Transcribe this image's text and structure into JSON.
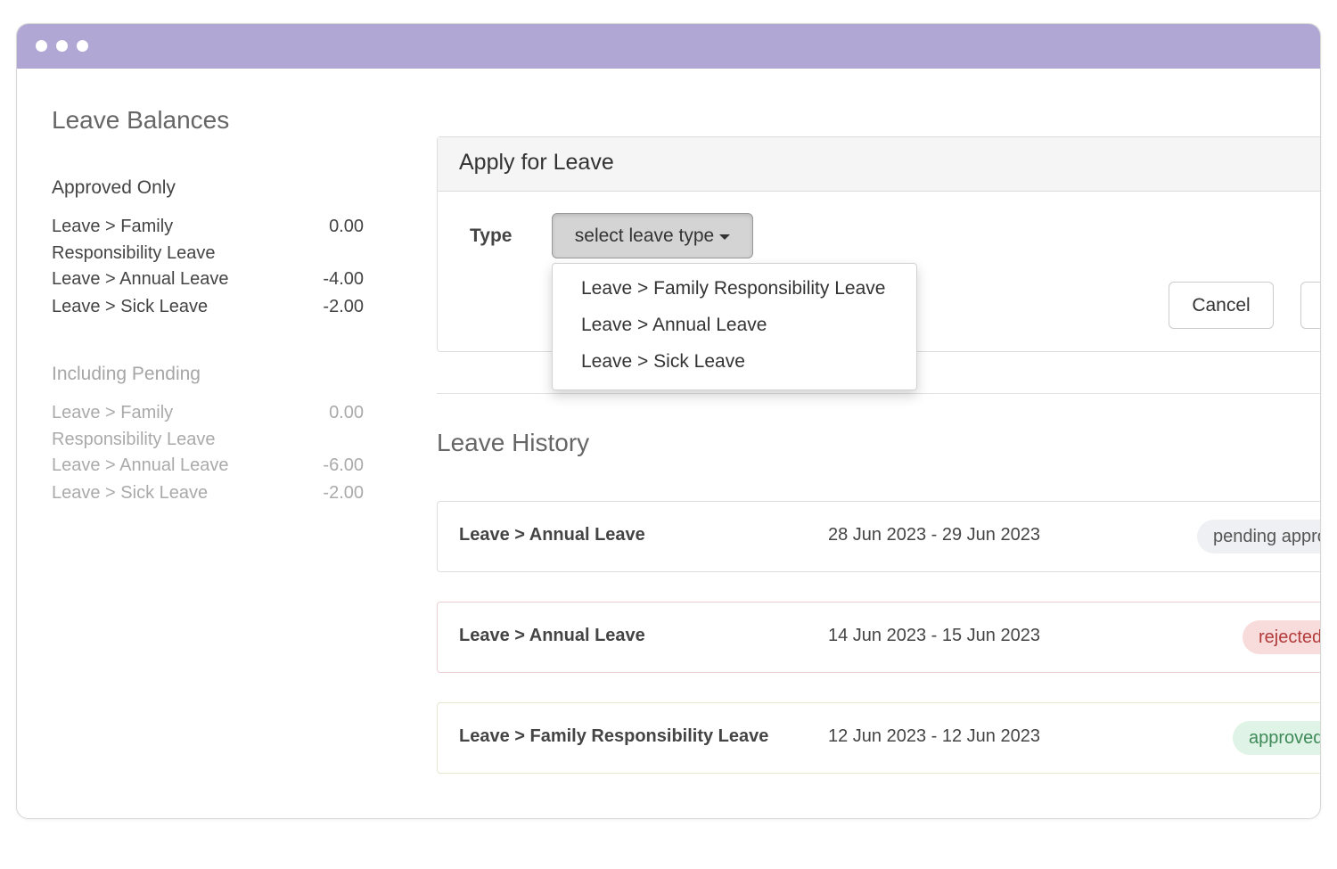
{
  "balances": {
    "title": "Leave Balances",
    "approved": {
      "title": "Approved Only",
      "items": [
        {
          "label": "Leave > Family Responsibility Leave",
          "value": "0.00"
        },
        {
          "label": "Leave > Annual Leave",
          "value": "-4.00"
        },
        {
          "label": "Leave > Sick Leave",
          "value": "-2.00"
        }
      ]
    },
    "pending": {
      "title": "Including Pending",
      "items": [
        {
          "label": "Leave > Family Responsibility Leave",
          "value": "0.00"
        },
        {
          "label": "Leave > Annual Leave",
          "value": "-6.00"
        },
        {
          "label": "Leave > Sick Leave",
          "value": "-2.00"
        }
      ]
    }
  },
  "apply": {
    "title": "Apply for Leave",
    "type_label": "Type",
    "select_label": "select leave type",
    "options": [
      "Leave > Family Responsibility Leave",
      "Leave > Annual Leave",
      "Leave > Sick Leave"
    ],
    "cancel_label": "Cancel"
  },
  "history": {
    "title": "Leave History",
    "rows": [
      {
        "type": "Leave > Annual Leave",
        "dates": "28 Jun 2023 - 29 Jun 2023",
        "status": "pending approval"
      },
      {
        "type": "Leave > Annual Leave",
        "dates": "14 Jun 2023 - 15 Jun 2023",
        "status": "rejected"
      },
      {
        "type": "Leave > Family Responsibility Leave",
        "dates": "12 Jun 2023 - 12 Jun 2023",
        "status": "approved"
      }
    ]
  },
  "colors": {
    "titlebar": "#b1a7d4",
    "pending_badge": "#eef0f3",
    "rejected_badge": "#f8dcdc",
    "approved_badge": "#dff3e6"
  }
}
